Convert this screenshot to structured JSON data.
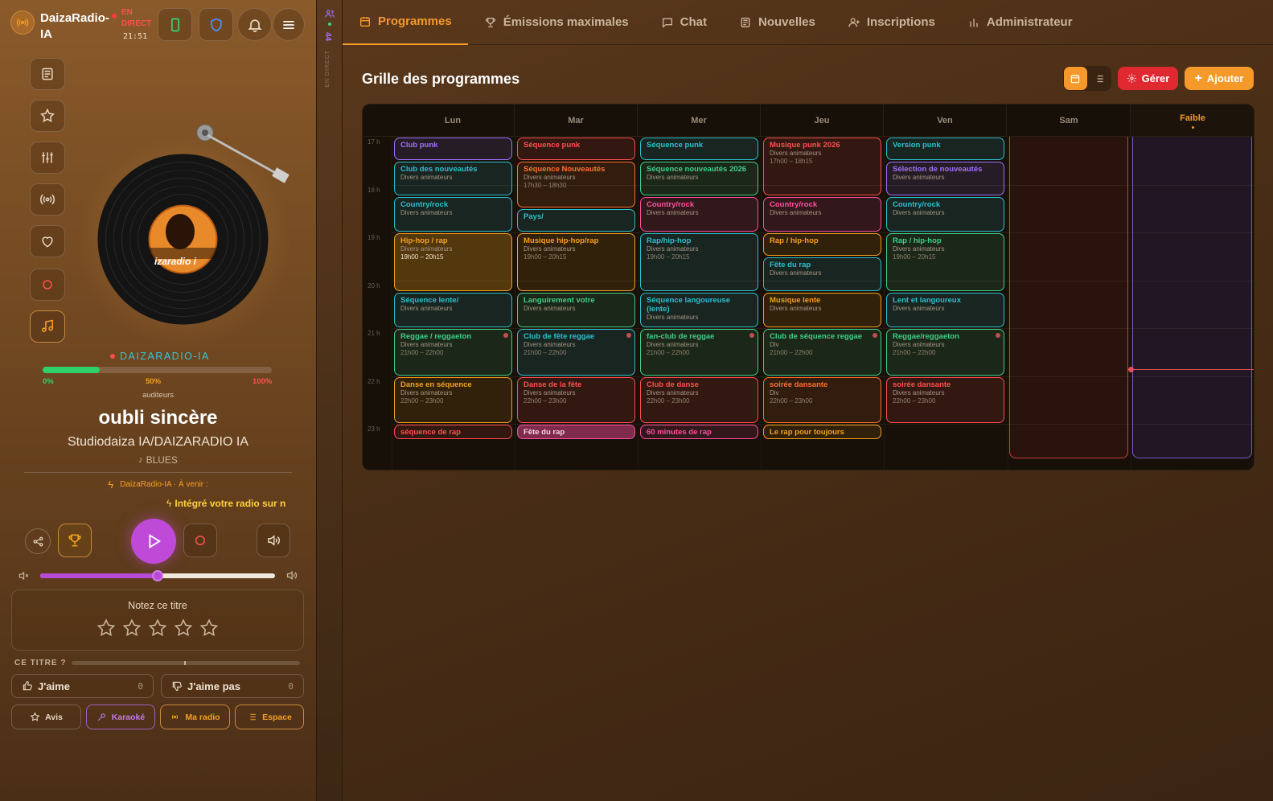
{
  "app": {
    "name_line1": "DaizaRadio-",
    "name_line2": "IA",
    "live1": "EN",
    "live2": "DIRECT",
    "time": "21:51"
  },
  "tabs": [
    {
      "label": "Programmes",
      "icon": "calendar-icon"
    },
    {
      "label": "Émissions maximales",
      "icon": "trophy-icon"
    },
    {
      "label": "Chat",
      "icon": "chat-icon"
    },
    {
      "label": "Nouvelles",
      "icon": "news-icon"
    },
    {
      "label": "Inscriptions",
      "icon": "user-plus-icon"
    },
    {
      "label": "Administrateur",
      "icon": "bar-chart-icon"
    }
  ],
  "strip": {
    "count": "44",
    "label": "EN DIRECT"
  },
  "grid": {
    "title": "Grille des programmes",
    "manage": "Gérer",
    "add": "Ajouter",
    "days": [
      "Lun",
      "Mar",
      "Mer",
      "Jeu",
      "Ven",
      "Sam",
      "Faible"
    ],
    "hours": [
      "17 h",
      "18 h",
      "19 h",
      "20 h",
      "21 h",
      "22 h",
      "23 h"
    ]
  },
  "events": [
    {
      "t": "Club punk",
      "d": 0,
      "s": 0,
      "e": 0.5,
      "c": "#a070ff"
    },
    {
      "t": "Club des nouveautés",
      "sub": "Divers animateurs",
      "d": 0,
      "s": 0.5,
      "e": 1.25,
      "c": "#2cc0d0"
    },
    {
      "t": "Country/rock",
      "sub": "Divers animateurs",
      "d": 0,
      "s": 1.25,
      "e": 2,
      "c": "#2cc0d0"
    },
    {
      "t": "Hip-hop / rap",
      "sub": "Divers animateurs",
      "hr": "19h00 – 20h15",
      "d": 0,
      "s": 2,
      "e": 3.25,
      "c": "#f5a020",
      "hot": true
    },
    {
      "t": "Séquence lente/",
      "sub": "Divers animateurs",
      "d": 0,
      "s": 3.25,
      "e": 4,
      "c": "#2cc0d0"
    },
    {
      "t": "Reggae / reggaeton",
      "sub": "Divers animateurs",
      "hr": "21h00 – 22h00",
      "d": 0,
      "s": 4,
      "e": 5,
      "c": "#3fd08a",
      "now": true
    },
    {
      "t": "Danse en séquence",
      "sub": "Divers animateurs",
      "hr": "22h00 – 23h00",
      "d": 0,
      "s": 5,
      "e": 6,
      "c": "#f5a020"
    },
    {
      "t": "séquence de rap",
      "d": 0,
      "s": 6,
      "e": 6.33,
      "c": "#ff4f4f"
    },
    {
      "t": "Séquence punk",
      "d": 1,
      "s": 0,
      "e": 0.5,
      "c": "#ff4f4f"
    },
    {
      "t": "Séquence Nouveautés",
      "sub": "Divers animateurs",
      "hr": "17h30 – 18h30",
      "d": 1,
      "s": 0.5,
      "e": 1.5,
      "c": "#ff7030"
    },
    {
      "t": "Pays/",
      "d": 1,
      "s": 1.5,
      "e": 2,
      "c": "#2cc0d0"
    },
    {
      "t": "Musique hip-hop/rap",
      "sub": "Divers animateurs",
      "hr": "19h00 – 20h15",
      "d": 1,
      "s": 2,
      "e": 3.25,
      "c": "#f5a020"
    },
    {
      "t": "Languirement votre",
      "sub": "Divers animateurs",
      "d": 1,
      "s": 3.25,
      "e": 4,
      "c": "#3fd08a"
    },
    {
      "t": "Club de fête reggae",
      "sub": "Divers animateurs",
      "hr": "21h00 – 22h00",
      "d": 1,
      "s": 4,
      "e": 5,
      "c": "#2cc0d0",
      "now": true
    },
    {
      "t": "Danse de la fête",
      "sub": "Divers animateurs",
      "hr": "22h00 – 23h00",
      "d": 1,
      "s": 5,
      "e": 6,
      "c": "#ff4f4f"
    },
    {
      "t": "Fête du rap",
      "d": 1,
      "s": 6,
      "e": 6.33,
      "c": "#ff4fa0",
      "fill": true
    },
    {
      "t": "Séquence punk",
      "d": 2,
      "s": 0,
      "e": 0.5,
      "c": "#2cc0d0"
    },
    {
      "t": "Séquence nouveautés 2026",
      "sub": "Divers animateurs",
      "d": 2,
      "s": 0.5,
      "e": 1.25,
      "c": "#3fd08a"
    },
    {
      "t": "Country/rock",
      "sub": "Divers animateurs",
      "d": 2,
      "s": 1.25,
      "e": 2,
      "c": "#ff4fa0"
    },
    {
      "t": "Rap/hip-hop",
      "sub": "Divers animateurs",
      "hr": "19h00 – 20h15",
      "d": 2,
      "s": 2,
      "e": 3.25,
      "c": "#2cc0d0"
    },
    {
      "t": "Séquence langoureuse (lente)",
      "sub": "Divers animateurs",
      "d": 2,
      "s": 3.25,
      "e": 4,
      "c": "#2cc0d0"
    },
    {
      "t": "fan-club de reggae",
      "sub": "Divers animateurs",
      "hr": "21h00 – 22h00",
      "d": 2,
      "s": 4,
      "e": 5,
      "c": "#3fd08a",
      "now": true
    },
    {
      "t": "Club de danse",
      "sub": "Divers animateurs",
      "hr": "22h00 – 23h00",
      "d": 2,
      "s": 5,
      "e": 6,
      "c": "#ff4f4f"
    },
    {
      "t": "60 minutes de rap",
      "d": 2,
      "s": 6,
      "e": 6.33,
      "c": "#ff4fa0"
    },
    {
      "t": "Musique punk 2026",
      "sub": "Divers animateurs",
      "hr": "17h00 – 18h15",
      "d": 3,
      "s": 0,
      "e": 1.25,
      "c": "#ff4f4f"
    },
    {
      "t": "Country/rock",
      "sub": "Divers animateurs",
      "d": 3,
      "s": 1.25,
      "e": 2,
      "c": "#ff4fa0"
    },
    {
      "t": "Rap / hip-hop",
      "d": 3,
      "s": 2,
      "e": 2.5,
      "c": "#f5a020"
    },
    {
      "t": "Fête du rap",
      "sub": "Divers animateurs",
      "d": 3,
      "s": 2.5,
      "e": 3.25,
      "c": "#2cc0d0"
    },
    {
      "t": "Musique lente",
      "sub": "Divers animateurs",
      "d": 3,
      "s": 3.25,
      "e": 4,
      "c": "#f5a020"
    },
    {
      "t": "Club de séquence reggae",
      "sub": "Div",
      "hr": "21h00 – 22h00",
      "d": 3,
      "s": 4,
      "e": 5,
      "c": "#3fd08a",
      "now": true
    },
    {
      "t": "soirée dansante",
      "sub": "Div",
      "hr": "22h00 – 23h00",
      "d": 3,
      "s": 5,
      "e": 6,
      "c": "#ff7030"
    },
    {
      "t": "Le rap pour toujours",
      "d": 3,
      "s": 6,
      "e": 6.33,
      "c": "#f5a020"
    },
    {
      "t": "Version punk",
      "d": 4,
      "s": 0,
      "e": 0.5,
      "c": "#2cc0d0"
    },
    {
      "t": "Sélection de nouveautés",
      "sub": "Divers animateurs",
      "d": 4,
      "s": 0.5,
      "e": 1.25,
      "c": "#a070ff"
    },
    {
      "t": "Country/rock",
      "sub": "Divers animateurs",
      "d": 4,
      "s": 1.25,
      "e": 2,
      "c": "#2cc0d0"
    },
    {
      "t": "Rap / hip-hop",
      "sub": "Divers animateurs",
      "hr": "19h00 – 20h15",
      "d": 4,
      "s": 2,
      "e": 3.25,
      "c": "#3fd08a"
    },
    {
      "t": "Lent et langoureux",
      "sub": "Divers animateurs",
      "d": 4,
      "s": 3.25,
      "e": 4,
      "c": "#2cc0d0"
    },
    {
      "t": "Reggae/reggaeton",
      "sub": "Divers animateurs",
      "hr": "21h00 – 22h00",
      "d": 4,
      "s": 4,
      "e": 5,
      "c": "#3fd08a",
      "now": true
    },
    {
      "t": "soirée dansante",
      "sub": "Divers animateurs",
      "hr": "22h00 – 23h00",
      "d": 4,
      "s": 5,
      "e": 6,
      "c": "#ff4f4f"
    }
  ],
  "player": {
    "brand": "DAIZARADIO-IA",
    "label_tag": "izaradio i",
    "progress_pct": 0.25,
    "p0": "0%",
    "p50": "50%",
    "p100": "100%",
    "listeners": "auditeurs",
    "title": "oubli sincère",
    "artist": "Studiodaiza IA/DAIZARADIO IA",
    "genre": "BLUES",
    "upcoming": "DaizaRadio-IA · À venir :",
    "ticker": "Intégré votre radio sur n",
    "volume_pct": 0.5,
    "rate_title": "Notez ce titre",
    "this_title": "CE TITRE ?",
    "like": "J'aime",
    "like_count": "0",
    "dislike": "J'aime pas",
    "dislike_count": "0",
    "b1": "Avis",
    "b2": "Karaoké",
    "b3": "Ma radio",
    "b4": "Espace"
  }
}
